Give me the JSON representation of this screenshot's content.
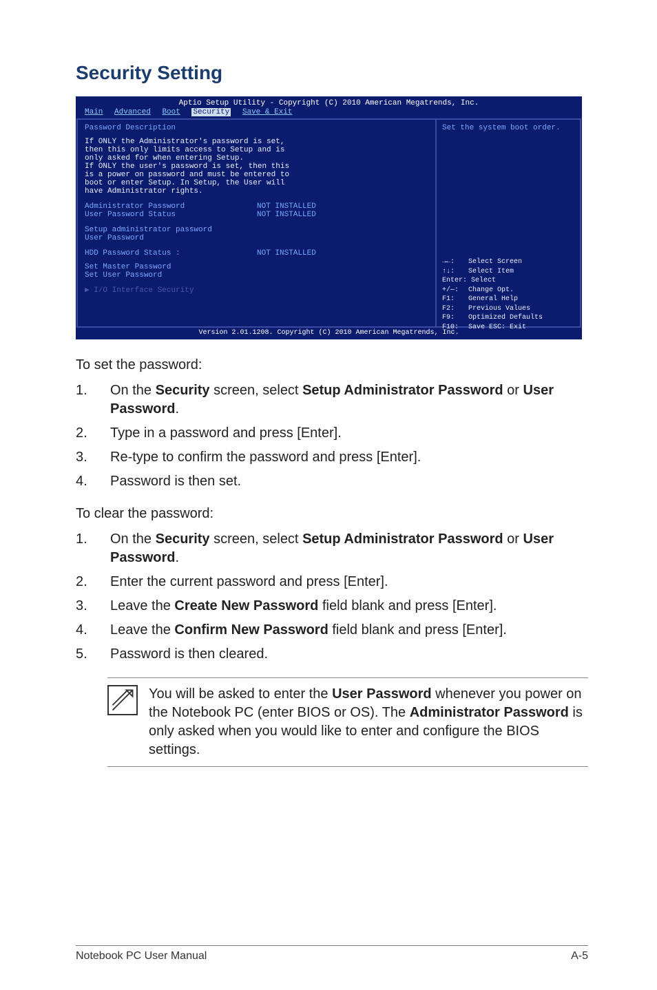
{
  "title": "Security Setting",
  "bios": {
    "header": "Aptio Setup Utility - Copyright (C) 2010 American Megatrends, Inc.",
    "footer": "Version 2.01.1208. Copyright (C) 2010 American Megatrends, Inc.",
    "tabs": {
      "main": "Main",
      "advanced": "Advanced",
      "boot": "Boot",
      "security": "Security",
      "save": "Save & Exit"
    },
    "left": {
      "heading": "Password Description",
      "desc1": "If ONLY the Administrator's password is set,",
      "desc2": "then this only limits access to Setup and is",
      "desc3": "only asked for when entering Setup.",
      "desc4": "If ONLY the user's password is set, then this",
      "desc5": "is a power on password and must be entered to",
      "desc6": "boot or enter Setup. In Setup, the User will",
      "desc7": "have Administrator rights.",
      "row1a": "Administrator Password",
      "row1b": "NOT INSTALLED",
      "row2a": "User Password Status",
      "row2b": "NOT INSTALLED",
      "setup_admin": "Setup administrator password",
      "user_pwd": "User Password",
      "row3a": "HDD Password Status :",
      "row3b": "NOT INSTALLED",
      "set_master": "Set Master Password",
      "set_user": "Set User Password",
      "io": "I/O Interface Security"
    },
    "right": {
      "top": "Set the system boot order.",
      "h1a": "→←:",
      "h1b": "Select Screen",
      "h2a": "↑↓:",
      "h2b": "Select Item",
      "h3": "Enter: Select",
      "h4a": "+/—:",
      "h4b": "Change Opt.",
      "h5a": "F1:",
      "h5b": "General Help",
      "h6a": "F2:",
      "h6b": "Previous Values",
      "h7a": "F9:",
      "h7b": "Optimized Defaults",
      "h8a": "F10:",
      "h8b": "Save   ESC: Exit"
    }
  },
  "body": {
    "set_intro": "To set the password:",
    "set1a": "On the ",
    "set1b": "Security",
    "set1c": " screen, select ",
    "set1d": "Setup Administrator Password",
    "set1e": " or ",
    "set1f": "User Password",
    "set1g": ".",
    "set2": "Type in a password and press [Enter].",
    "set3": "Re-type to confirm the password and press [Enter].",
    "set4": "Password is then set.",
    "clear_intro": "To clear the password:",
    "clr1a": "On the ",
    "clr1b": "Security",
    "clr1c": " screen, select ",
    "clr1d": "Setup Administrator Password",
    "clr1e": " or ",
    "clr1f": "User Password",
    "clr1g": ".",
    "clr2": "Enter the current password and press [Enter].",
    "clr3a": "Leave the ",
    "clr3b": "Create New Password",
    "clr3c": " field blank and press [Enter].",
    "clr4a": "Leave the ",
    "clr4b": "Confirm New Password",
    "clr4c": " field blank and press [Enter].",
    "clr5": "Password is then cleared."
  },
  "note": {
    "t1": "You will be asked to enter the ",
    "t2": "User Password",
    "t3": " whenever you power on the Notebook PC (enter BIOS or OS). The ",
    "t4": "Administrator Password",
    "t5": " is only asked when you would like to enter and configure the BIOS settings."
  },
  "footer": {
    "left": "Notebook PC User Manual",
    "right": "A-5"
  },
  "nums": {
    "n1": "1.",
    "n2": "2.",
    "n3": "3.",
    "n4": "4.",
    "n5": "5."
  }
}
